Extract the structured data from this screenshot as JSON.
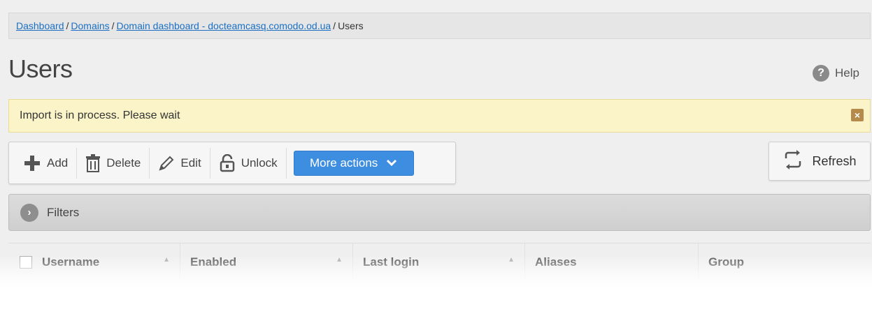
{
  "breadcrumb": {
    "items": [
      "Dashboard",
      "Domains",
      "Domain dashboard - docteamcasq.comodo.od.ua"
    ],
    "current": "Users",
    "separator": "/"
  },
  "page": {
    "title": "Users"
  },
  "help": {
    "label": "Help",
    "icon": "?"
  },
  "notice": {
    "text": "Import is in process. Please wait",
    "close_icon": "×"
  },
  "toolbar": {
    "add": "Add",
    "delete": "Delete",
    "edit": "Edit",
    "unlock": "Unlock",
    "more_actions": "More actions"
  },
  "refresh": {
    "label": "Refresh"
  },
  "filters": {
    "label": "Filters",
    "icon": "›"
  },
  "table": {
    "columns": [
      "Username",
      "Enabled",
      "Last login",
      "Aliases",
      "Group"
    ]
  },
  "colors": {
    "accent": "#3d8ee0",
    "notice_bg": "#faf4c8",
    "link": "#1a6fc4"
  }
}
